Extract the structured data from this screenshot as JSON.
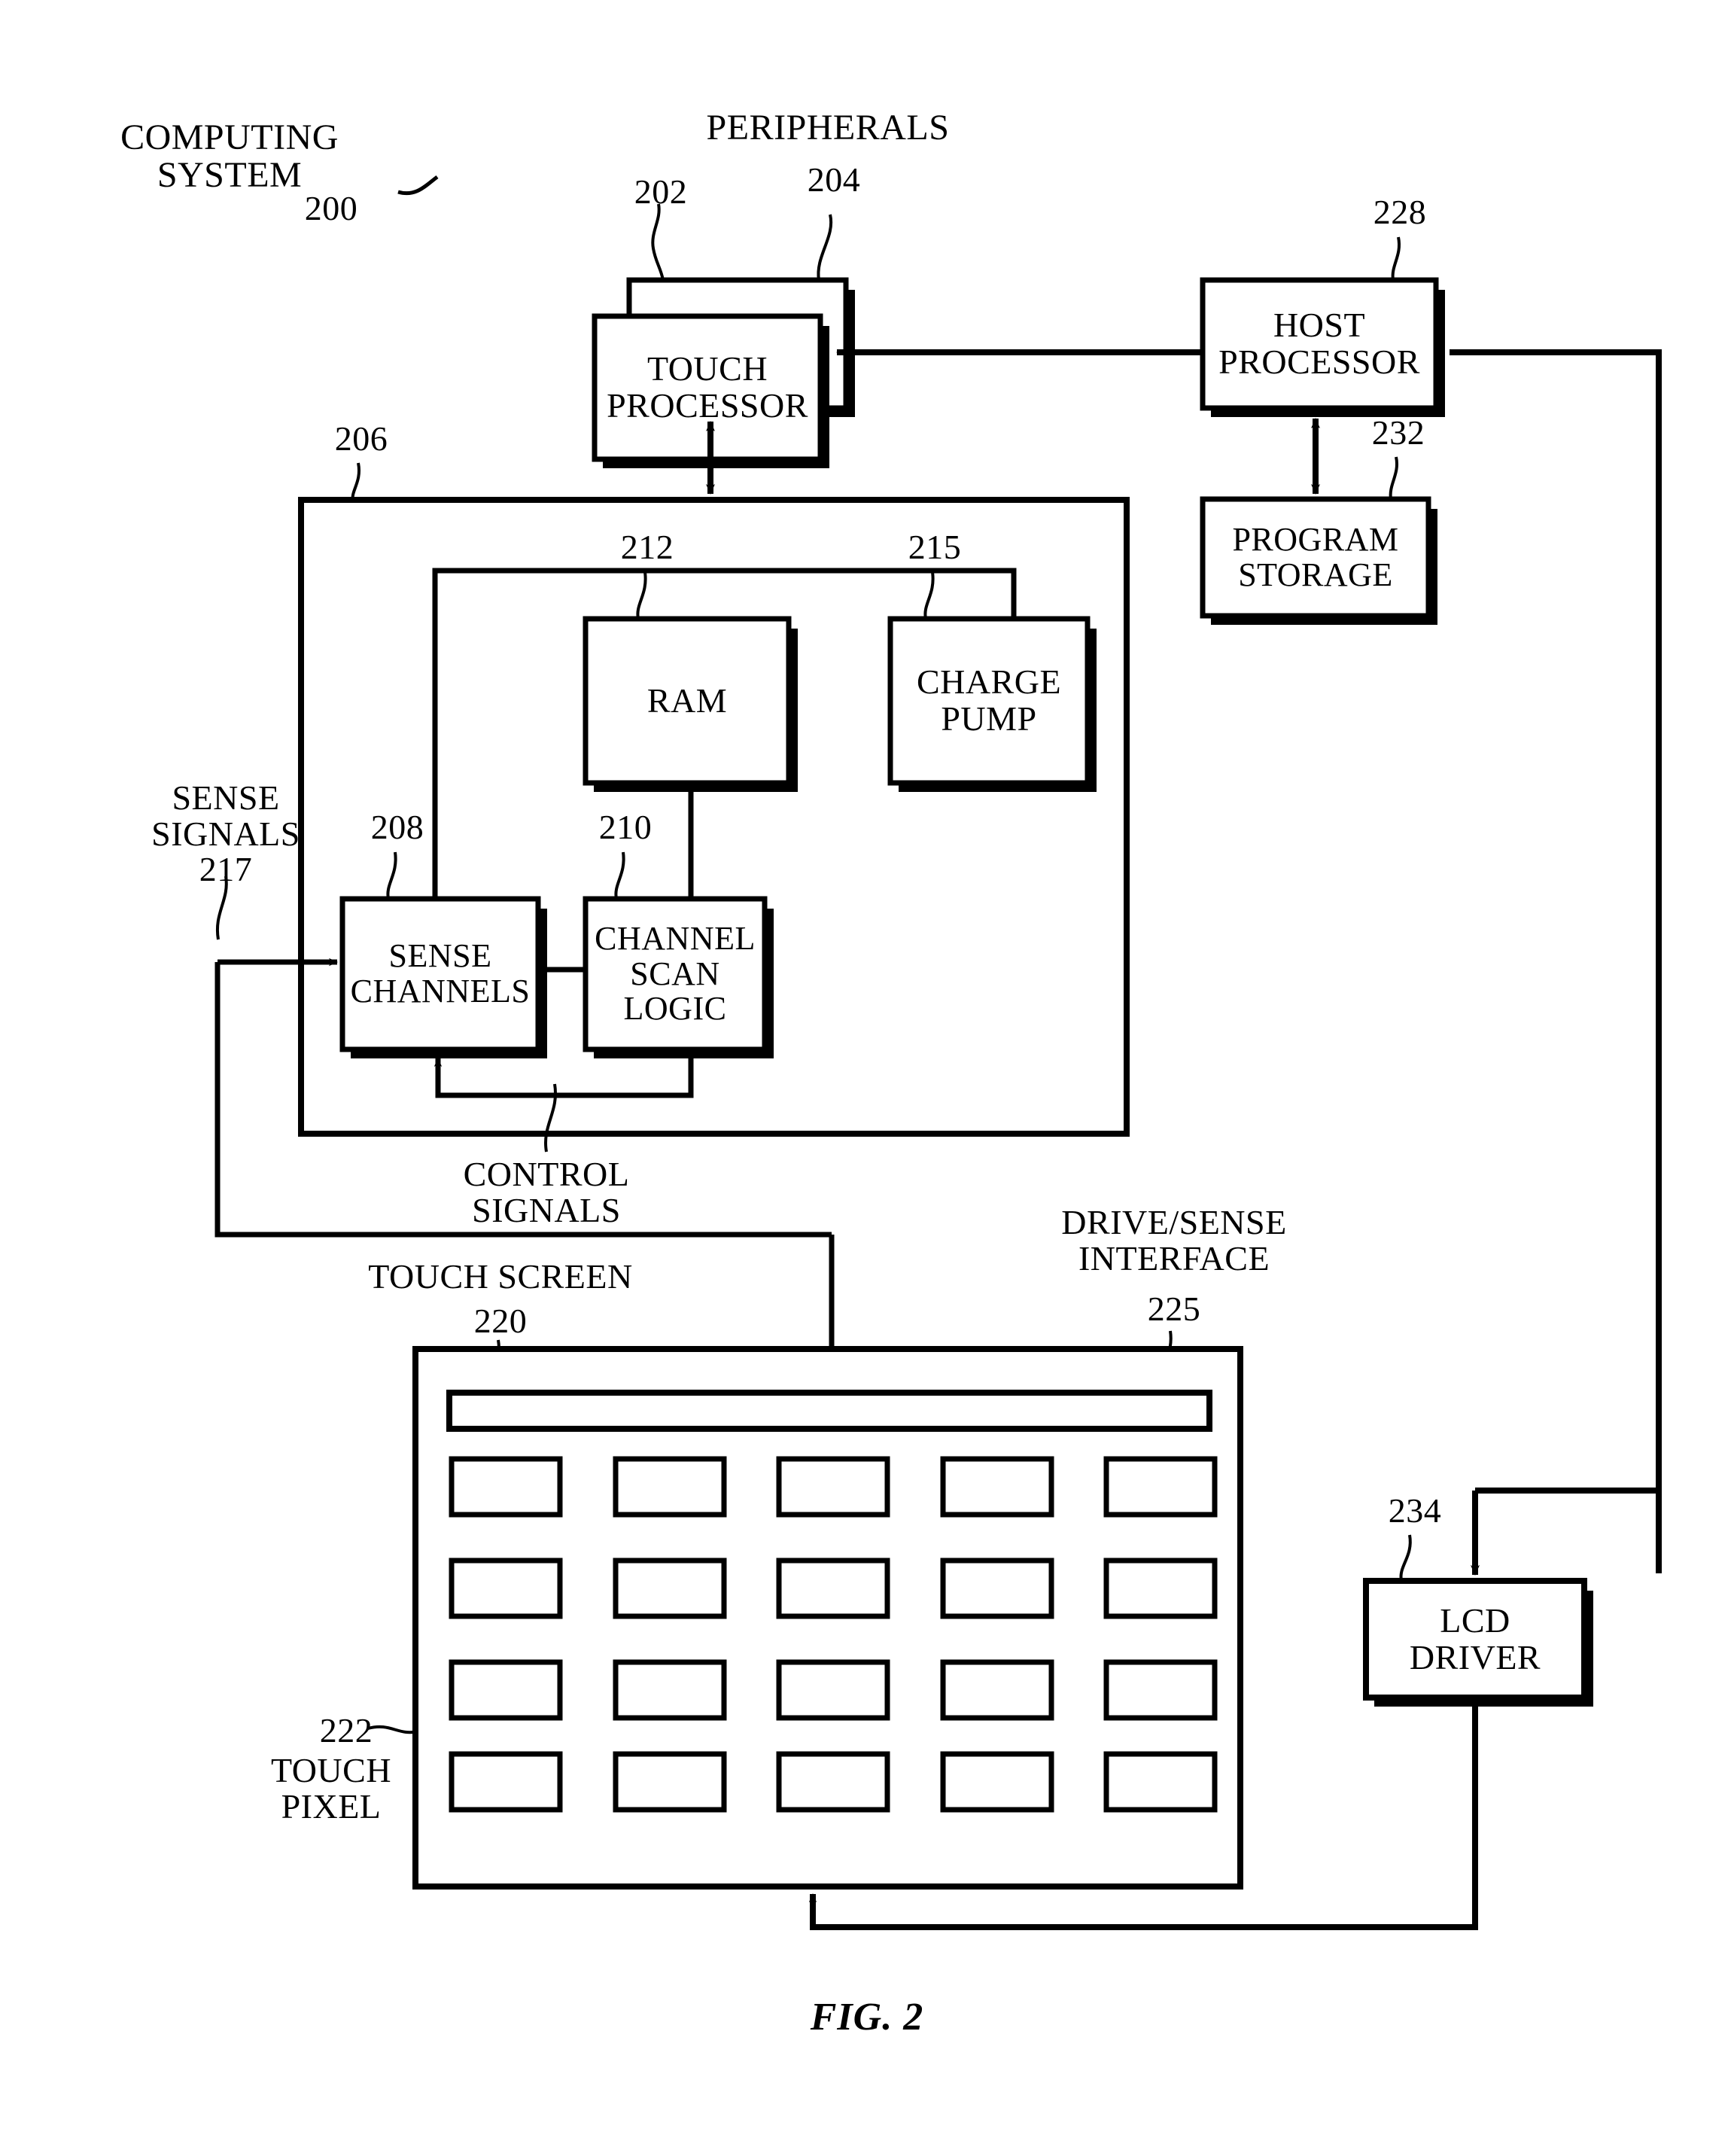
{
  "figure": {
    "caption": "FIG. 2",
    "title_label": "COMPUTING\nSYSTEM",
    "title_ref": "200"
  },
  "blocks": [
    {
      "id": "peripherals",
      "label": "",
      "ref": "204",
      "ref_label": "PERIPHERALS"
    },
    {
      "id": "touch-processor",
      "label": "TOUCH\nPROCESSOR",
      "ref": "202"
    },
    {
      "id": "host-processor",
      "label": "HOST\nPROCESSOR",
      "ref": "228"
    },
    {
      "id": "program-storage",
      "label": "PROGRAM\nSTORAGE",
      "ref": "232"
    },
    {
      "id": "touch-controller",
      "label": "",
      "ref": "206"
    },
    {
      "id": "ram",
      "label": "RAM",
      "ref": "212"
    },
    {
      "id": "charge-pump",
      "label": "CHARGE\nPUMP",
      "ref": "215"
    },
    {
      "id": "sense-channels",
      "label": "SENSE\nCHANNELS",
      "ref": "208"
    },
    {
      "id": "channel-scan-logic",
      "label": "CHANNEL\nSCAN\nLOGIC",
      "ref": "210"
    },
    {
      "id": "touch-screen",
      "label": "TOUCH SCREEN",
      "ref": "220"
    },
    {
      "id": "drive-sense-interface",
      "label": "DRIVE/SENSE\nINTERFACE",
      "ref": "225"
    },
    {
      "id": "touch-pixel",
      "label": "TOUCH\nPIXEL",
      "ref": "222"
    },
    {
      "id": "lcd-driver",
      "label": "LCD\nDRIVER",
      "ref": "234"
    }
  ],
  "signals": [
    {
      "id": "sense-signals",
      "label": "SENSE\nSIGNALS",
      "ref": "217"
    },
    {
      "id": "control-signals",
      "label": "CONTROL\nSIGNALS",
      "ref": ""
    }
  ],
  "text": {
    "computing_system": "COMPUTING\nSYSTEM",
    "ref_200": "200",
    "peripherals": "PERIPHERALS",
    "ref_204": "204",
    "ref_202": "202",
    "touch_processor": "TOUCH\nPROCESSOR",
    "host_processor": "HOST\nPROCESSOR",
    "ref_228": "228",
    "program_storage": "PROGRAM\nSTORAGE",
    "ref_232": "232",
    "ref_206": "206",
    "ram": "RAM",
    "ref_212": "212",
    "charge_pump": "CHARGE\nPUMP",
    "ref_215": "215",
    "sense_channels": "SENSE\nCHANNELS",
    "ref_208": "208",
    "channel_scan_logic": "CHANNEL\nSCAN\nLOGIC",
    "ref_210": "210",
    "sense_signals": "SENSE\nSIGNALS",
    "ref_217": "217",
    "control_signals": "CONTROL\nSIGNALS",
    "touch_screen": "TOUCH SCREEN",
    "ref_220": "220",
    "drive_sense_interface": "DRIVE/SENSE\nINTERFACE",
    "ref_225": "225",
    "touch_pixel": "TOUCH\nPIXEL",
    "ref_222": "222",
    "lcd_driver": "LCD\nDRIVER",
    "ref_234": "234",
    "fig_caption": "FIG. 2"
  },
  "touch_pixel_grid": {
    "rows": 4,
    "cols": 5
  },
  "colors": {
    "ink": "#000000",
    "paper": "#ffffff"
  }
}
